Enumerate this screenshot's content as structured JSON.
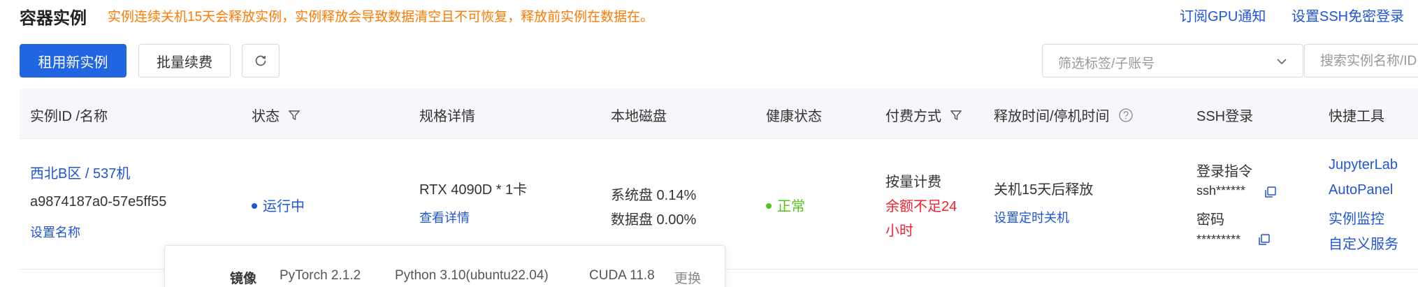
{
  "header": {
    "title": "容器实例",
    "notice": "实例连续关机15天会释放实例，实例释放会导致数据清空且不可恢复，释放前实例在数据在。",
    "links": [
      "订阅GPU通知",
      "设置SSH免密登录"
    ]
  },
  "toolbar": {
    "rent_new": "租用新实例",
    "batch_renew": "批量续费",
    "tag_filter_placeholder": "筛选标签/子账号",
    "search_placeholder": "搜索实例名称/ID"
  },
  "table": {
    "columns": [
      "实例ID /名称",
      "状态",
      "规格详情",
      "本地磁盘",
      "健康状态",
      "付费方式",
      "释放时间/停机时间",
      "SSH登录",
      "快捷工具"
    ],
    "row": {
      "region_machine": "西北B区 / 537机",
      "instance_id": "a9874187a0-57e5ff55",
      "set_name": "设置名称",
      "status": "运行中",
      "spec": "RTX 4090D * 1卡",
      "spec_detail_link": "查看详情",
      "disk_system": "系统盘 0.14%",
      "disk_data": "数据盘 0.00%",
      "health": "正常",
      "billing": "按量计费",
      "balance_warning": [
        "余额不足24",
        "小时"
      ],
      "release": "关机15天后释放",
      "set_shutdown": "设置定时关机",
      "ssh_login_cmd_label": "登录指令",
      "ssh_cmd_value": "ssh******",
      "ssh_password_label": "密码",
      "ssh_password_value": "*********",
      "tools": [
        "JupyterLab",
        "AutoPanel",
        "实例监控",
        "自定义服务"
      ]
    }
  },
  "popover": {
    "image_label": "镜像",
    "pytorch": "PyTorch  2.1.2",
    "python": "Python  3.10(ubuntu22.04)",
    "cuda": "CUDA  11.8",
    "change": "更换"
  },
  "colors": {
    "primary": "#2165e0",
    "link": "#1f55d6",
    "warning": "#ff7a00",
    "danger": "#f5222d",
    "success": "#52c41a",
    "header_bg": "#f5f7fa"
  },
  "icons": [
    "refresh-icon",
    "chevron-down-icon",
    "filter-icon",
    "help-circle-icon",
    "copy-icon"
  ]
}
